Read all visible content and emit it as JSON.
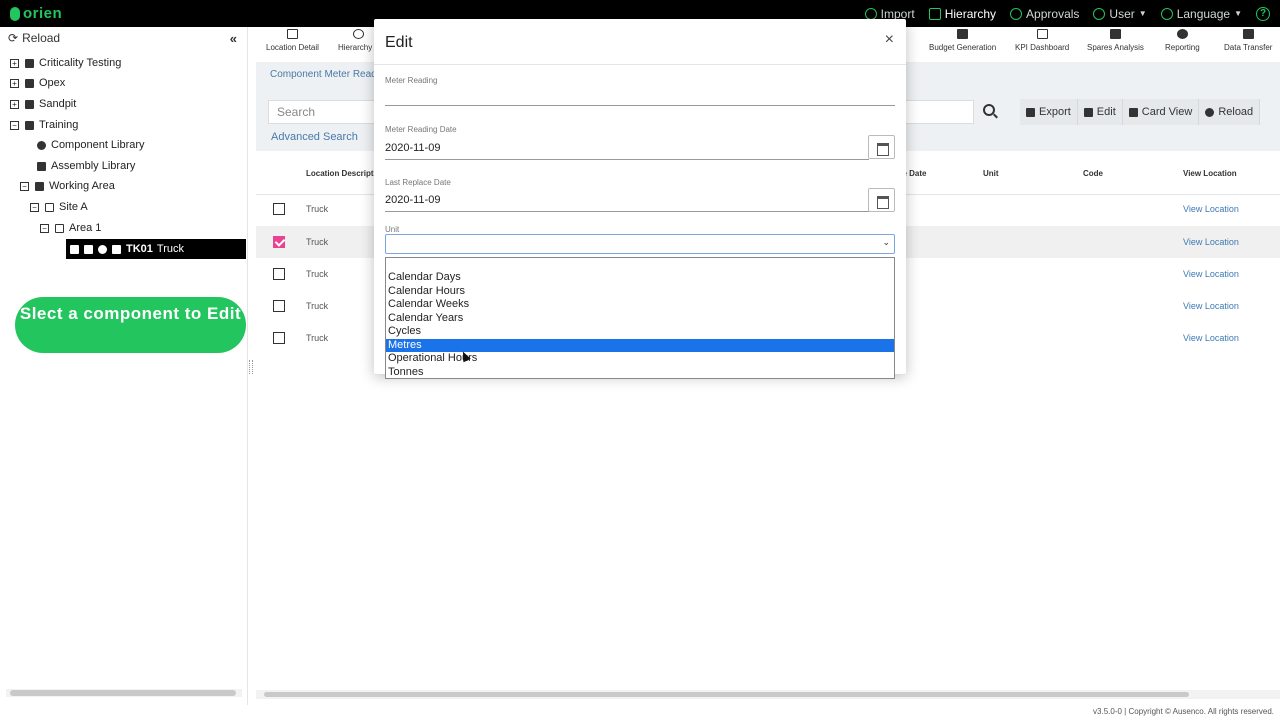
{
  "app": {
    "logo_text": "orien",
    "brand_color": "#22c55e"
  },
  "topnav": [
    {
      "label": "Import",
      "icon": "import-icon"
    },
    {
      "label": "Hierarchy",
      "icon": "hierarchy-icon"
    },
    {
      "label": "Approvals",
      "icon": "approvals-icon"
    },
    {
      "label": "User",
      "icon": "user-icon"
    },
    {
      "label": "Language",
      "icon": "globe-icon"
    }
  ],
  "sidebar": {
    "reload_label": "Reload",
    "tree": [
      {
        "label": "Criticality Testing",
        "toggle": "+"
      },
      {
        "label": "Opex",
        "toggle": "+"
      },
      {
        "label": "Sandpit",
        "toggle": "+"
      },
      {
        "label": "Training",
        "toggle": "−"
      },
      {
        "label": "Component Library"
      },
      {
        "label": "Assembly Library"
      },
      {
        "label": "Working Area",
        "toggle": "−"
      },
      {
        "label": "Site A",
        "toggle": "−"
      },
      {
        "label": "Area 1",
        "toggle": "−"
      },
      {
        "label_code": "TK01",
        "label_name": "Truck"
      }
    ],
    "hint": "Slect a component to Edit"
  },
  "toolbar": [
    {
      "label": "Location Detail"
    },
    {
      "label": "Hierarchy V"
    },
    {
      "label": "Budget Generation"
    },
    {
      "label": "KPI Dashboard"
    },
    {
      "label": "Spares Analysis"
    },
    {
      "label": "Reporting"
    },
    {
      "label": "Data Transfer"
    }
  ],
  "tab_label": "Component Meter Readi",
  "search": {
    "placeholder": "Search",
    "advanced_label": "Advanced Search"
  },
  "actions": [
    {
      "label": "Export"
    },
    {
      "label": "Edit"
    },
    {
      "label": "Card View"
    },
    {
      "label": "Reload"
    }
  ],
  "grid": {
    "headers": [
      "Location Descripti",
      "ce Date",
      "Unit",
      "Code",
      "View Location"
    ],
    "rows": [
      {
        "desc": "Truck",
        "link": "View Location",
        "checked": false
      },
      {
        "desc": "Truck",
        "link": "View Location",
        "checked": true
      },
      {
        "desc": "Truck",
        "link": "View Location",
        "checked": false
      },
      {
        "desc": "Truck",
        "link": "View Location",
        "checked": false
      },
      {
        "desc": "Truck",
        "link": "View Location",
        "checked": false
      }
    ]
  },
  "footer": "v3.5.0-0 | Copyright © Ausenco. All rights reserved.",
  "modal": {
    "title": "Edit",
    "close": "×",
    "meter_reading": {
      "label": "Meter Reading",
      "value": ""
    },
    "meter_reading_date": {
      "label": "Meter Reading Date",
      "value": "2020-11-09"
    },
    "last_replace_date": {
      "label": "Last Replace Date",
      "value": "2020-11-09"
    },
    "unit": {
      "label": "Unit",
      "value": ""
    }
  },
  "unit_options": [
    "Calendar Days",
    "Calendar Hours",
    "Calendar Weeks",
    "Calendar Years",
    "Cycles",
    "Metres",
    "Operational Hours",
    "Tonnes"
  ],
  "unit_highlighted": "Metres"
}
